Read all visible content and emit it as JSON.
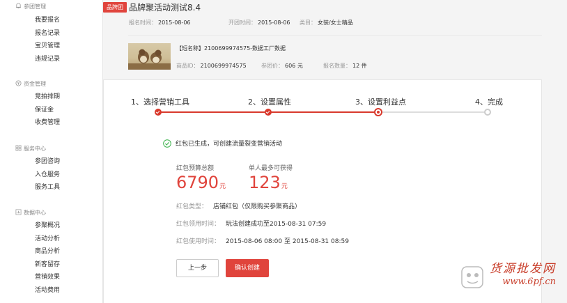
{
  "sidebar": {
    "sections": [
      {
        "title": "参团管理",
        "icon": "bell-icon",
        "items": [
          "我要报名",
          "报名记录",
          "宝贝管理",
          "违规记录"
        ]
      },
      {
        "title": "资金管理",
        "icon": "money-icon",
        "items": [
          "竞拍排期",
          "保证金",
          "收费管理"
        ]
      },
      {
        "title": "服务中心",
        "icon": "grid-icon",
        "items": [
          "参团咨询",
          "入仓服务",
          "服务工具"
        ]
      },
      {
        "title": "数据中心",
        "icon": "chart-icon",
        "items": [
          "参聚概况",
          "活动分析",
          "商品分析",
          "新客留存",
          "营销效果",
          "活动费用"
        ]
      }
    ]
  },
  "header": {
    "badge": "品牌团",
    "title": "品牌聚活动测试8.4",
    "meta": [
      {
        "label": "报名时间：",
        "value": "2015-08-06"
      },
      {
        "label": "开团时间：",
        "value": "2015-08-06"
      },
      {
        "label": "类目：",
        "value": "女装/女士精品"
      }
    ]
  },
  "product": {
    "name": "【短名称】2100699974575-数据工厂数据",
    "meta": [
      {
        "label": "商品ID：",
        "value": "2100699974575"
      },
      {
        "label": "参团价：",
        "value": "606 元"
      },
      {
        "label": "报名数量：",
        "value": "12 件"
      }
    ]
  },
  "steps": [
    {
      "label": "1、选择营销工具",
      "state": "done"
    },
    {
      "label": "2、设置属性",
      "state": "done"
    },
    {
      "label": "3、设置利益点",
      "state": "current"
    },
    {
      "label": "4、完成",
      "state": "todo"
    }
  ],
  "result": {
    "message": "红包已生成，可创建流量裂变营销活动",
    "budget_label": "红包预算总额",
    "budget_value": "6790",
    "budget_unit": "元",
    "max_label": "单人最多可获得",
    "max_value": "123",
    "max_unit": "元",
    "details": [
      {
        "label": "红包类型：",
        "value": "店铺红包（仅限购买参聚商品）"
      },
      {
        "label": "红包领用时间：",
        "value": "玩法创建成功至2015-08-31 07:59"
      },
      {
        "label": "红包使用时间：",
        "value": "2015-08-06 08:00 至 2015-08-31 08:59"
      }
    ]
  },
  "buttons": {
    "prev": "上一步",
    "confirm": "确认创建"
  },
  "watermark": {
    "line1": "货源批发网",
    "line2": "www.6pf.cn"
  },
  "colors": {
    "accent": "#e0443c",
    "progress": "#d9392c",
    "success": "#3bb24b"
  }
}
